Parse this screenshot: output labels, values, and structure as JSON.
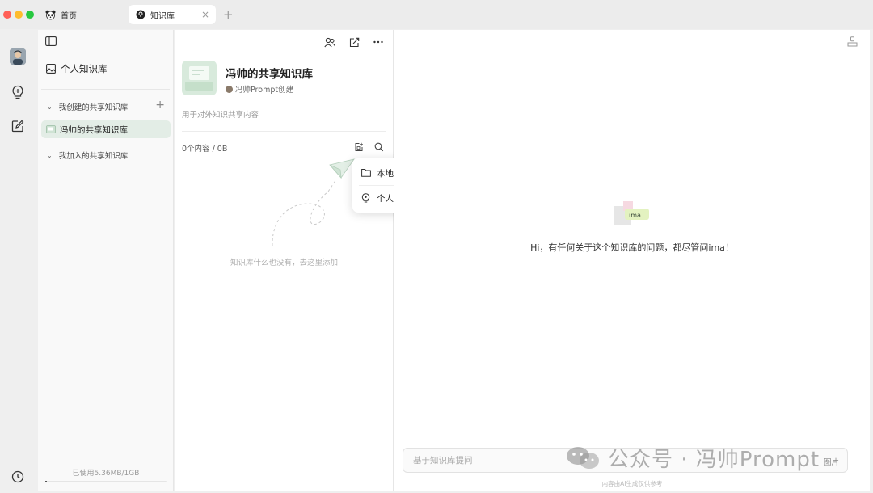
{
  "tabs": [
    {
      "label": "首页",
      "icon": "panda-icon"
    },
    {
      "label": "知识库",
      "icon": "lightbulb-icon",
      "active": true
    }
  ],
  "tab_close": "×",
  "tab_new": "+",
  "rail": {
    "icons": [
      "avatar",
      "lightbulb-icon",
      "edit-icon",
      "clock-icon"
    ]
  },
  "sidebar": {
    "personal_label": "个人知识库",
    "created_group_label": "我创建的共享知识库",
    "add_symbol": "+",
    "active_item_label": "冯帅的共享知识库",
    "joined_group_label": "我加入的共享知识库",
    "usage_text": "已使用5.36MB/1GB",
    "usage_fraction": 0.005
  },
  "kb": {
    "title": "冯帅的共享知识库",
    "owner": "冯帅Prompt创建",
    "description": "用于对外知识共享内容",
    "count_text": "0个内容 / 0B",
    "empty_text": "知识库什么也没有，去这里添加"
  },
  "popup": {
    "items": [
      {
        "label": "本地文件",
        "icon": "folder-icon"
      },
      {
        "label": "个人知识库",
        "icon": "lightbulb-icon"
      }
    ]
  },
  "chat": {
    "logo_text": "ima.",
    "greeting": "Hi，有任何关于这个知识库的问题，都尽管问ima！",
    "input_placeholder": "基于知识库提问",
    "mode_label": "图片",
    "footer": "内容由AI生成仅供参考"
  },
  "watermark": {
    "text": "公众号 · 冯帅Prompt"
  },
  "colors": {
    "accent_green": "#e3ede6",
    "arrow_red": "#e8432e"
  }
}
